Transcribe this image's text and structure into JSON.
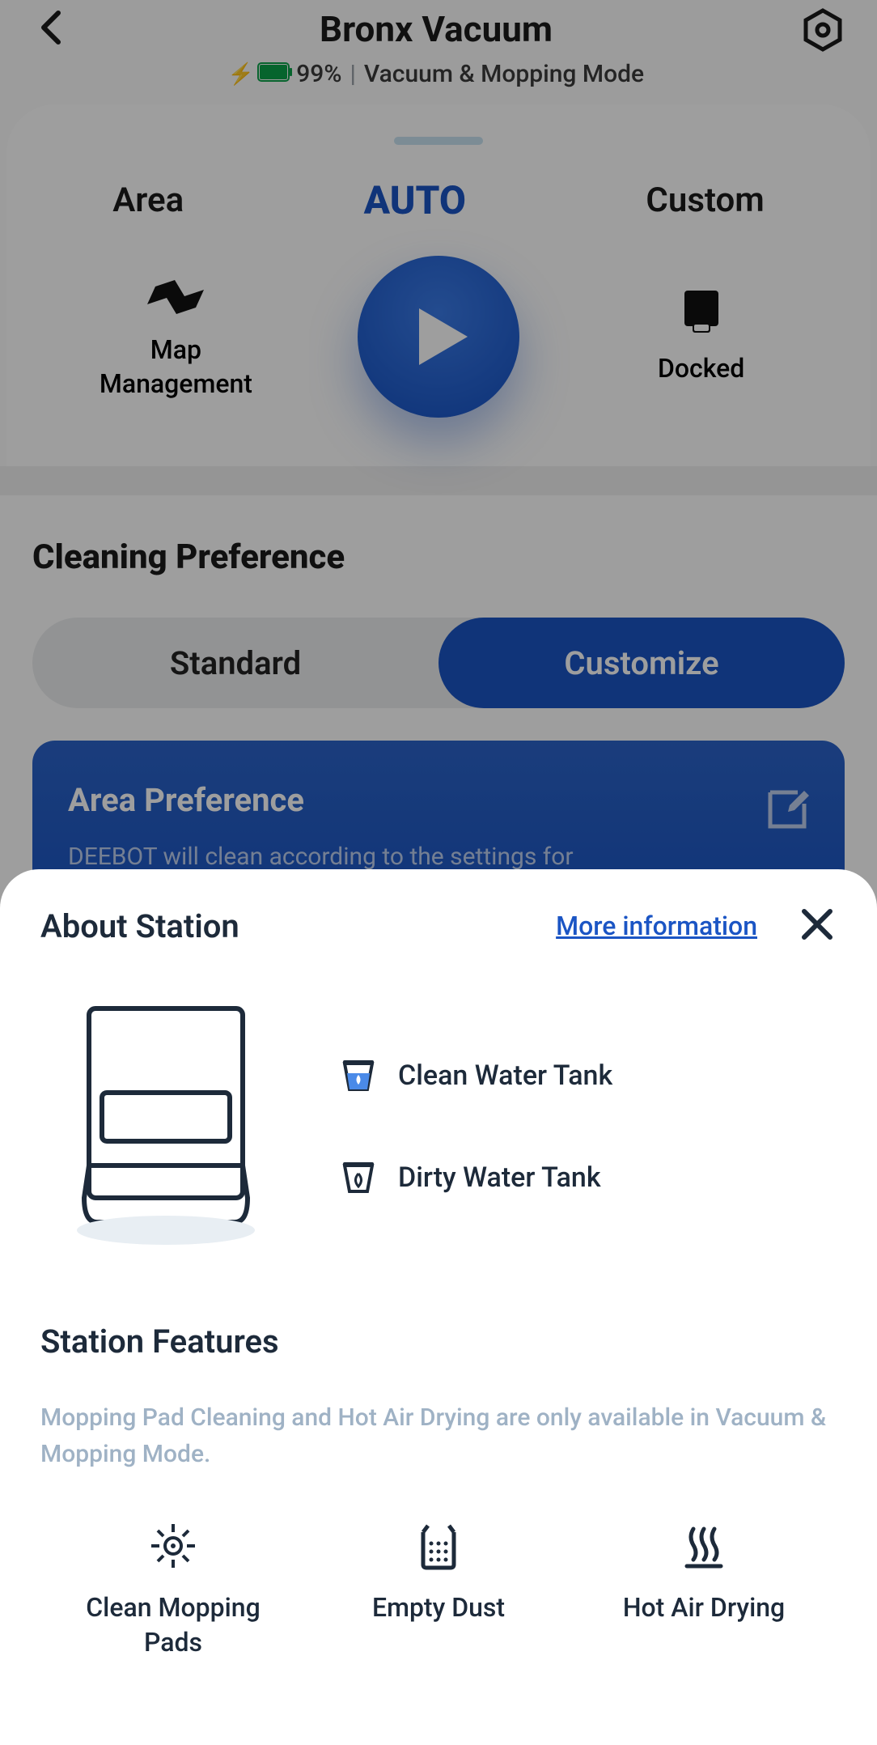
{
  "header": {
    "title": "Bronx Vacuum",
    "battery_percent": "99%",
    "mode": "Vacuum & Mopping Mode"
  },
  "modes": {
    "area": "Area",
    "auto": "AUTO",
    "custom": "Custom"
  },
  "actions": {
    "map_management": "Map\nManagement",
    "docked": "Docked"
  },
  "cleaning_pref": {
    "title": "Cleaning Preference",
    "standard": "Standard",
    "customize": "Customize",
    "area_pref_title": "Area Preference",
    "area_pref_desc": "DEEBOT will clean according to the settings for"
  },
  "sheet": {
    "title": "About Station",
    "more_link": "More information",
    "clean_tank": "Clean Water Tank",
    "dirty_tank": "Dirty Water Tank",
    "features_title": "Station Features",
    "features_note": "Mopping Pad Cleaning and Hot Air Drying are only available in Vacuum & Mopping Mode.",
    "features": {
      "clean_pads": "Clean Mopping\nPads",
      "empty_dust": "Empty Dust",
      "hot_air": "Hot Air Drying"
    }
  }
}
